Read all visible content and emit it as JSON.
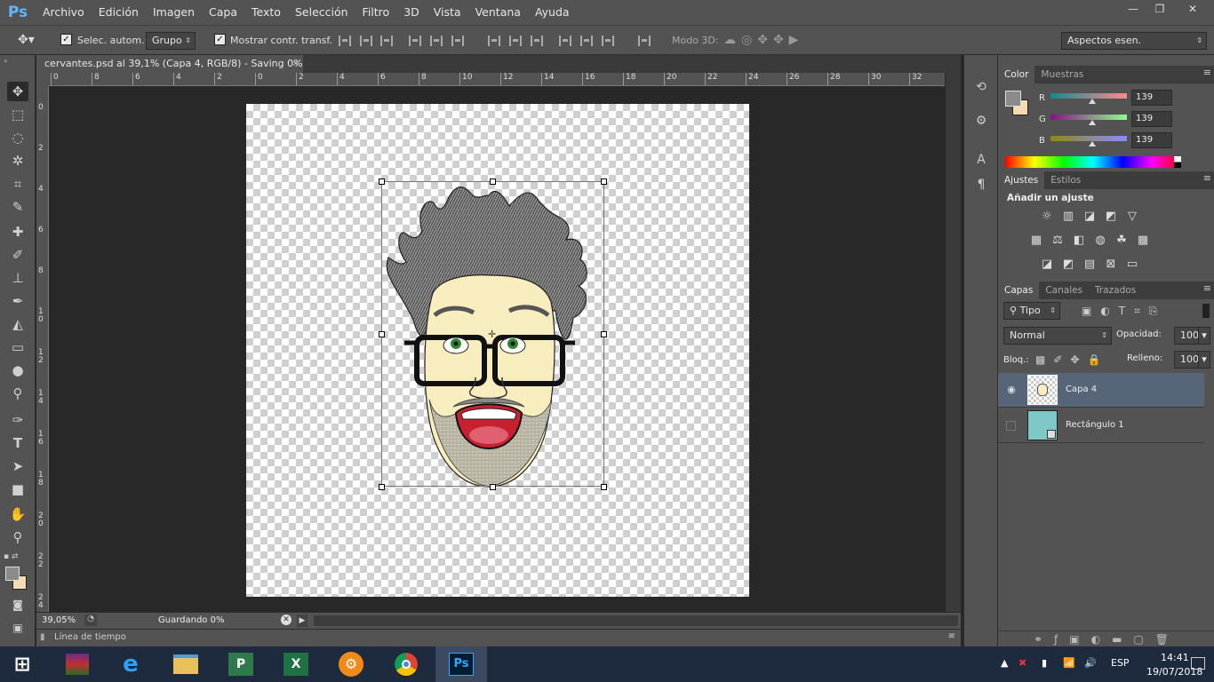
{
  "app": {
    "logo": "Ps"
  },
  "menu": [
    "Archivo",
    "Edición",
    "Imagen",
    "Capa",
    "Texto",
    "Selección",
    "Filtro",
    "3D",
    "Vista",
    "Ventana",
    "Ayuda"
  ],
  "window_controls": {
    "minimize": "—",
    "restore": "❐",
    "close": "✕"
  },
  "options_bar": {
    "auto_select_label": "Selec. autom.:",
    "auto_select_checked": true,
    "group_dropdown": "Grupo",
    "show_transform_label": "Mostrar contr. transf.",
    "show_transform_checked": true,
    "mode3d_label": "Modo 3D:",
    "workspace": "Aspectos esen."
  },
  "document": {
    "tab_title": "cervantes.psd al 39,1% (Capa 4, RGB/8) - Saving 0%",
    "close": "×"
  },
  "ruler": {
    "top_labels": [
      "0",
      "8",
      "6",
      "4",
      "2",
      "0",
      "2",
      "4",
      "6",
      "8",
      "10",
      "12",
      "14",
      "16",
      "18",
      "20",
      "22",
      "24",
      "26",
      "28",
      "30",
      "32"
    ],
    "left_labels": [
      "0",
      "2",
      "4",
      "6",
      "8",
      "1 0",
      "1 2",
      "1 4",
      "1 6",
      "1 8",
      "2 0",
      "2 2",
      "2 4"
    ]
  },
  "status": {
    "zoom": "39,05%",
    "saving_text": "Guardando 0%"
  },
  "timeline": {
    "label": "Línea de tiempo"
  },
  "color_panel": {
    "tabs": [
      "Color",
      "Muestras"
    ],
    "channels": [
      {
        "label": "R",
        "value": "139",
        "color": "#e07070"
      },
      {
        "label": "G",
        "value": "139",
        "color": "#9050b0"
      },
      {
        "label": "B",
        "value": "139",
        "color": "#9090d0"
      }
    ],
    "foreground": "#8b8b8b",
    "background": "#f5dbb0"
  },
  "adjust_panel": {
    "tabs": [
      "Ajustes",
      "Estilos"
    ],
    "title": "Añadir un ajuste"
  },
  "layers_panel": {
    "tabs": [
      "Capas",
      "Canales",
      "Trazados"
    ],
    "kind_filter": "Tipo",
    "blend_mode": "Normal",
    "opacity_label": "Opacidad:",
    "opacity_value": "100%",
    "lock_label": "Bloq.:",
    "fill_label": "Relleno:",
    "fill_value": "100%",
    "layers": [
      {
        "name": "Capa 4",
        "visible": true,
        "selected": true
      },
      {
        "name": "Rectángulo 1",
        "visible": false,
        "selected": false
      }
    ]
  },
  "taskbar": {
    "apps": [
      "winrar",
      "ie",
      "explorer",
      "powerpoint",
      "excel",
      "unknown",
      "chrome",
      "photoshop"
    ],
    "lang": "ESP",
    "time": "14:41",
    "date": "19/07/2018"
  }
}
